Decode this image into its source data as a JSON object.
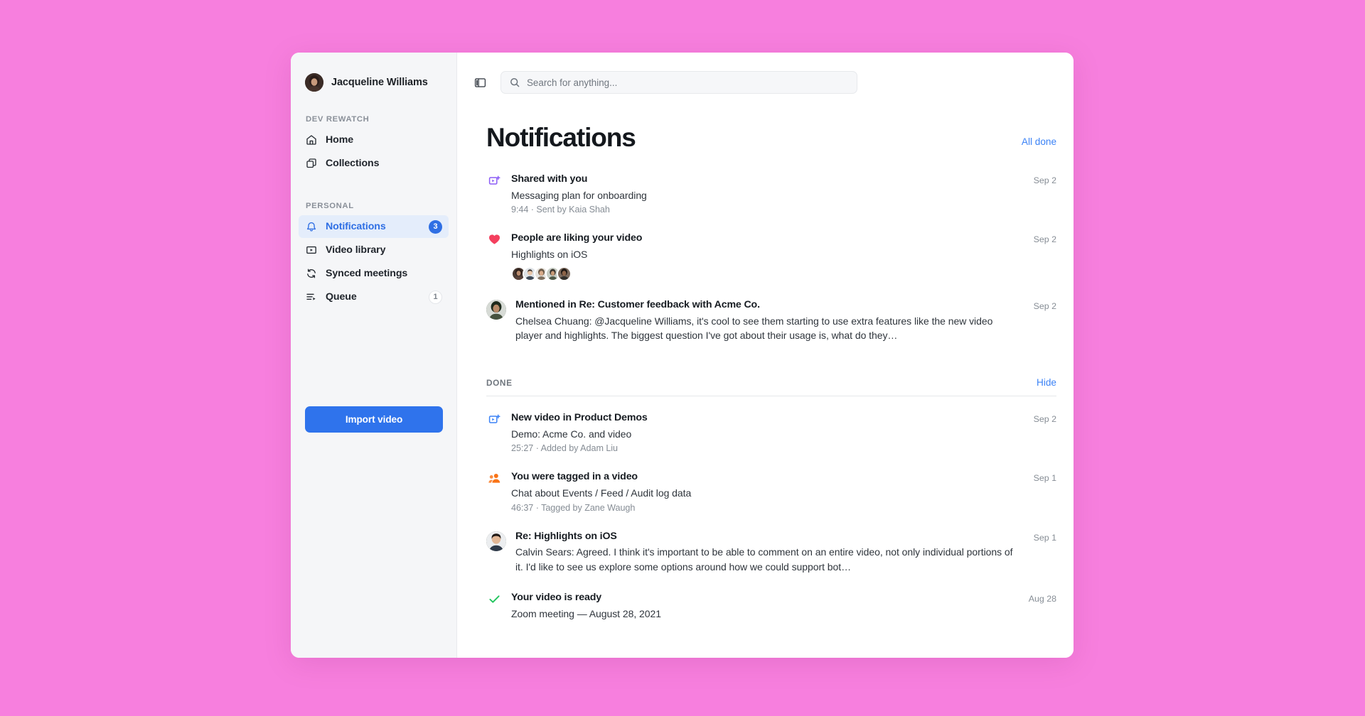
{
  "window": {
    "background_color": "#f77fde",
    "surface_color": "#ffffff"
  },
  "sidebar": {
    "user": {
      "name": "Jacqueline Williams",
      "avatar": "user-avatar"
    },
    "groups": [
      {
        "label": "DEV REWATCH",
        "items": [
          {
            "label": "Home",
            "icon": "home-icon",
            "active": false,
            "badge": ""
          },
          {
            "label": "Collections",
            "icon": "collections-icon",
            "active": false,
            "badge": ""
          }
        ]
      },
      {
        "label": "PERSONAL",
        "items": [
          {
            "label": "Notifications",
            "icon": "bell-icon",
            "active": true,
            "badge": "3"
          },
          {
            "label": "Video library",
            "icon": "video-icon",
            "active": false,
            "badge": ""
          },
          {
            "label": "Synced meetings",
            "icon": "sync-icon",
            "active": false,
            "badge": ""
          },
          {
            "label": "Queue",
            "icon": "queue-icon",
            "active": false,
            "badge": "1"
          }
        ]
      }
    ],
    "import_button": {
      "label": "Import video",
      "color": "#2f73ec"
    }
  },
  "topbar": {
    "panel_toggle_icon": "sidebar-toggle-icon",
    "search": {
      "placeholder": "Search for anything...",
      "value": "",
      "icon": "search-icon"
    }
  },
  "page": {
    "title": "Notifications",
    "all_done_label": "All done",
    "accent_color": "#3b82f6"
  },
  "unread": [
    {
      "icon": "shared-video-icon",
      "icon_color": "#8b5cf6",
      "title": "Shared with you",
      "subtitle": "Messaging plan for onboarding",
      "meta": "9:44 · Sent by Kaia Shah",
      "date": "Sep 2"
    },
    {
      "icon": "heart-icon",
      "icon_color": "#f43f5e",
      "title": "People are liking your video",
      "subtitle": "Highlights on iOS",
      "meta": "",
      "date": "Sep 2",
      "avatars": 5
    },
    {
      "icon": "avatar",
      "title": "Mentioned in Re: Customer feedback with Acme Co.",
      "subtitle": "Chelsea Chuang: @Jacqueline Williams, it's cool to see them starting to use extra features like the new video player and highlights. The biggest question I've got about their usage is, what do they…",
      "meta": "",
      "date": "Sep 2"
    }
  ],
  "done_section": {
    "label": "DONE",
    "hide_label": "Hide"
  },
  "done": [
    {
      "icon": "new-video-icon",
      "icon_color": "#3b82f6",
      "title": "New video in Product Demos",
      "subtitle": "Demo: Acme Co. and video",
      "meta": "25:27 · Added by Adam Liu",
      "date": "Sep 2"
    },
    {
      "icon": "tagged-people-icon",
      "icon_color": "#f97316",
      "title": "You were tagged in a video",
      "subtitle": "Chat about Events / Feed / Audit log data",
      "meta": "46:37 · Tagged by Zane Waugh",
      "date": "Sep 1"
    },
    {
      "icon": "avatar",
      "title": "Re: Highlights on iOS",
      "subtitle": "Calvin Sears: Agreed. I think it's important to be able to comment on an entire video, not only individual portions of it. I'd like to see us explore some options around how we could support bot…",
      "meta": "",
      "date": "Sep 1"
    },
    {
      "icon": "check-icon",
      "icon_color": "#22c55e",
      "title": "Your video is ready",
      "subtitle": "Zoom meeting — August 28, 2021",
      "meta": "",
      "date": "Aug 28"
    }
  ]
}
